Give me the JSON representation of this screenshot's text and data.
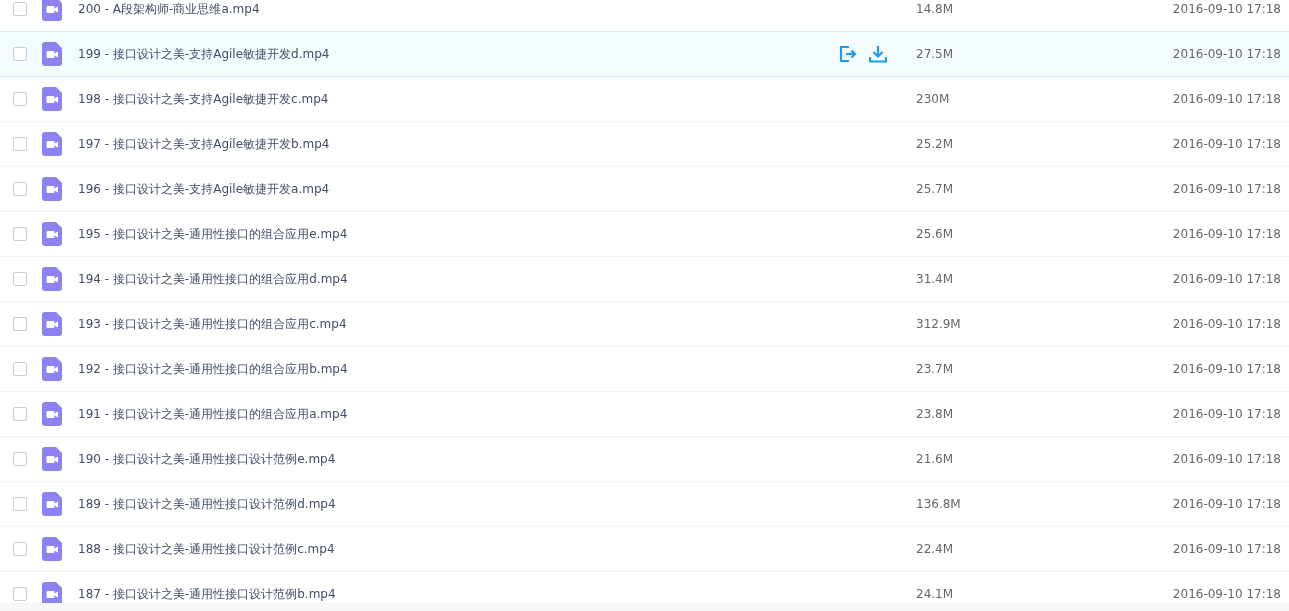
{
  "files": [
    {
      "name": "200 - A段架构师-商业思维a.mp4",
      "size": "14.8M",
      "modified": "2016-09-10 17:18",
      "selected": false
    },
    {
      "name": "199 - 接口设计之美-支持Agile敏捷开发d.mp4",
      "size": "27.5M",
      "modified": "2016-09-10 17:18",
      "selected": true
    },
    {
      "name": "198 - 接口设计之美-支持Agile敏捷开发c.mp4",
      "size": "230M",
      "modified": "2016-09-10 17:18",
      "selected": false
    },
    {
      "name": "197 - 接口设计之美-支持Agile敏捷开发b.mp4",
      "size": "25.2M",
      "modified": "2016-09-10 17:18",
      "selected": false
    },
    {
      "name": "196 - 接口设计之美-支持Agile敏捷开发a.mp4",
      "size": "25.7M",
      "modified": "2016-09-10 17:18",
      "selected": false
    },
    {
      "name": "195 - 接口设计之美-通用性接口的组合应用e.mp4",
      "size": "25.6M",
      "modified": "2016-09-10 17:18",
      "selected": false
    },
    {
      "name": "194 - 接口设计之美-通用性接口的组合应用d.mp4",
      "size": "31.4M",
      "modified": "2016-09-10 17:18",
      "selected": false
    },
    {
      "name": "193 - 接口设计之美-通用性接口的组合应用c.mp4",
      "size": "312.9M",
      "modified": "2016-09-10 17:18",
      "selected": false
    },
    {
      "name": "192 - 接口设计之美-通用性接口的组合应用b.mp4",
      "size": "23.7M",
      "modified": "2016-09-10 17:18",
      "selected": false
    },
    {
      "name": "191 - 接口设计之美-通用性接口的组合应用a.mp4",
      "size": "23.8M",
      "modified": "2016-09-10 17:18",
      "selected": false
    },
    {
      "name": "190 - 接口设计之美-通用性接口设计范例e.mp4",
      "size": "21.6M",
      "modified": "2016-09-10 17:18",
      "selected": false
    },
    {
      "name": "189 - 接口设计之美-通用性接口设计范例d.mp4",
      "size": "136.8M",
      "modified": "2016-09-10 17:18",
      "selected": false
    },
    {
      "name": "188 - 接口设计之美-通用性接口设计范例c.mp4",
      "size": "22.4M",
      "modified": "2016-09-10 17:18",
      "selected": false
    },
    {
      "name": "187 - 接口设计之美-通用性接口设计范例b.mp4",
      "size": "24.1M",
      "modified": "2016-09-10 17:18",
      "selected": false
    }
  ]
}
